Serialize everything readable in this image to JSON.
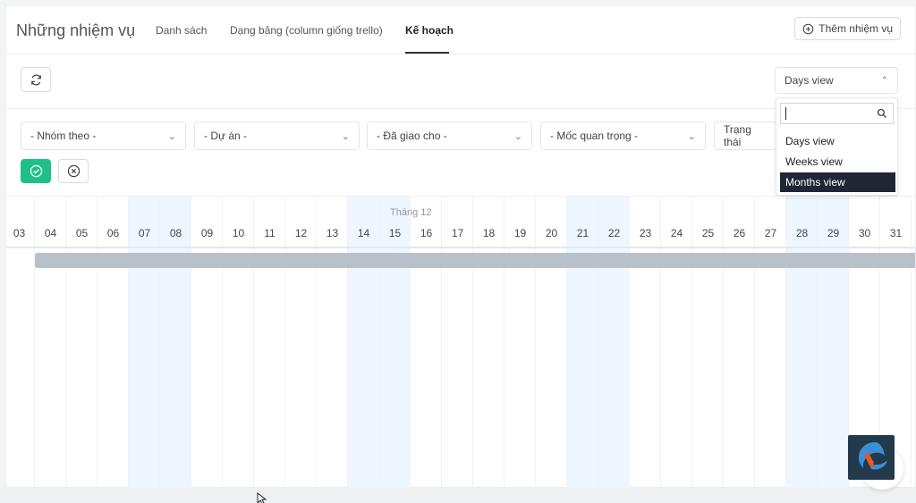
{
  "header": {
    "title": "Những nhiệm vụ",
    "tabs": [
      {
        "label": "Danh sách"
      },
      {
        "label": "Dạng bảng (column giống trello)"
      },
      {
        "label": "Kế hoạch"
      }
    ],
    "add_task_label": "Thêm nhiệm vụ"
  },
  "toolbar": {
    "view_select_value": "Days view"
  },
  "filters": {
    "group_by": "- Nhóm theo -",
    "project": "- Dự án -",
    "assigned_to": "- Đã giao cho -",
    "milestone": "- Mốc quan trọng -",
    "status": "Trạng thái"
  },
  "dropdown": {
    "options": [
      "Days view",
      "Weeks view",
      "Months view"
    ],
    "selected": "Months view"
  },
  "gantt": {
    "month": "Tháng 12",
    "days": [
      "03",
      "04",
      "05",
      "06",
      "07",
      "08",
      "09",
      "10",
      "11",
      "12",
      "13",
      "14",
      "15",
      "16",
      "17",
      "18",
      "19",
      "20",
      "21",
      "22",
      "23",
      "24",
      "25",
      "26",
      "27",
      "28",
      "29",
      "30",
      "31"
    ],
    "weekend_days": [
      "07",
      "08",
      "14",
      "15",
      "21",
      "22",
      "28",
      "29"
    ]
  },
  "colors": {
    "accent_green": "#1fbf8a",
    "weekend_bg": "#eef6ff",
    "task_bar": "#b8c0c9",
    "selected_option_bg": "#1f2735"
  }
}
